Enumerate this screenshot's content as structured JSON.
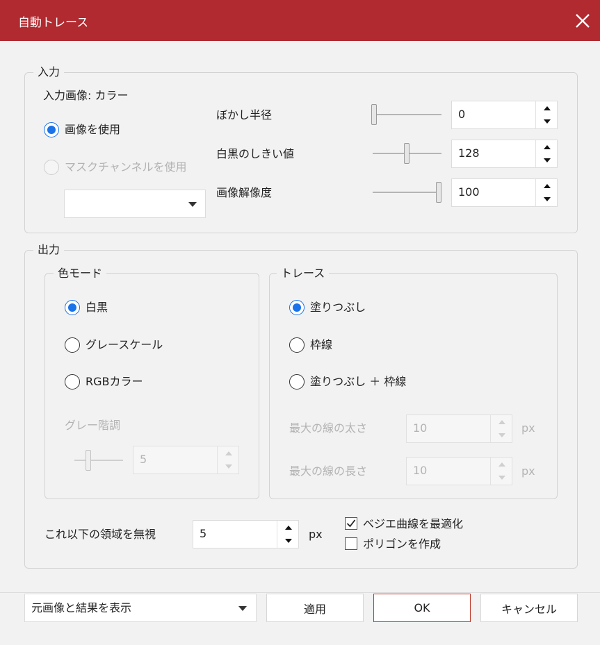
{
  "window": {
    "title": "自動トレース"
  },
  "input": {
    "legend": "入力",
    "image_label": "入力画像: カラー",
    "radio_use_image": "画像を使用",
    "radio_mask_channel": "マスクチャンネルを使用",
    "mask_dropdown_value": "",
    "blur_label": "ぼかし半径",
    "blur_value": "0",
    "blur_level": 0.0,
    "threshold_label": "白黒のしきい値",
    "threshold_value": "128",
    "threshold_level": 0.5,
    "resolution_label": "画像解像度",
    "resolution_value": "100",
    "resolution_level": 1.0
  },
  "output": {
    "legend": "出力",
    "color_mode": {
      "legend": "色モード",
      "options": [
        "白黒",
        "グレースケール",
        "RGBカラー"
      ],
      "selected": 0,
      "gray_levels_label": "グレー階調",
      "gray_levels_value": "5"
    },
    "trace": {
      "legend": "トレース",
      "options": [
        "塗りつぶし",
        "枠線",
        "塗りつぶし ＋ 枠線"
      ],
      "selected": 0,
      "max_width_label": "最大の線の太さ",
      "max_width_value": "10",
      "max_length_label": "最大の線の長さ",
      "max_length_value": "10",
      "unit": "px"
    },
    "ignore_label": "これ以下の領域を無視",
    "ignore_value": "5",
    "ignore_unit": "px",
    "optimize_bezier_label": "ベジエ曲線を最適化",
    "optimize_bezier_checked": true,
    "create_polygon_label": "ポリゴンを作成",
    "create_polygon_checked": false
  },
  "footer": {
    "preview_mode_value": "元画像と結果を表示",
    "apply_label": "適用",
    "ok_label": "OK",
    "cancel_label": "キャンセル"
  },
  "colors": {
    "titlebar": "#b02a30",
    "accent": "#1a73e8",
    "primary_border": "#c0392b"
  },
  "icons": [
    "close-icon",
    "chevron-down-icon",
    "spin-up-icon",
    "spin-down-icon",
    "checkmark-icon"
  ]
}
